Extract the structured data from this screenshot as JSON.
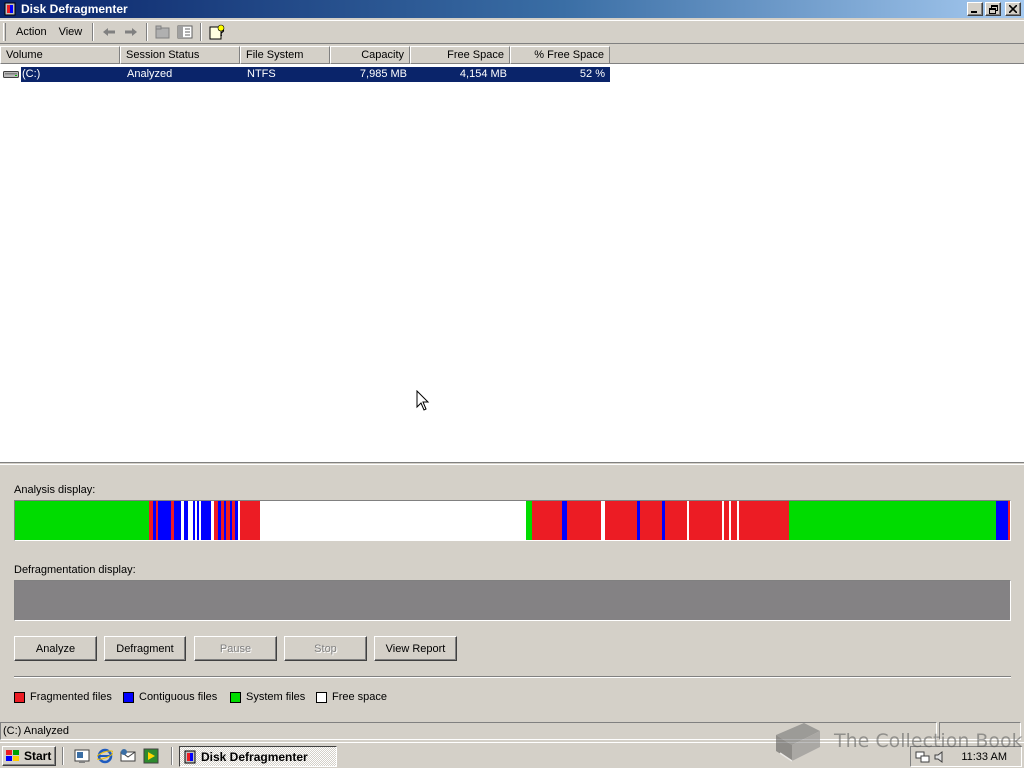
{
  "window": {
    "title": "Disk Defragmenter",
    "controls": [
      "minimize-icon",
      "restore-icon",
      "close-icon"
    ]
  },
  "menu": {
    "items": [
      {
        "label": "Action"
      },
      {
        "label": "View"
      }
    ],
    "toolbar_icons": [
      "back-arrow-icon",
      "forward-arrow-icon",
      "up-folder-icon",
      "show-hide-tree-icon",
      "help-icon"
    ]
  },
  "volume_list": {
    "columns": [
      {
        "label": "Volume"
      },
      {
        "label": "Session Status"
      },
      {
        "label": "File System"
      },
      {
        "label": "Capacity"
      },
      {
        "label": "Free Space"
      },
      {
        "label": "% Free Space"
      }
    ],
    "rows": [
      {
        "volume": "(C:)",
        "session_status": "Analyzed",
        "file_system": "NTFS",
        "capacity": "7,985 MB",
        "free_space": "4,154 MB",
        "percent_free": "52 %",
        "selected": true
      }
    ]
  },
  "analysis": {
    "label": "Analysis display:",
    "segments": [
      {
        "type": "system",
        "units": 124
      },
      {
        "type": "fragmented",
        "units": 3
      },
      {
        "type": "contiguous",
        "units": 3
      },
      {
        "type": "fragmented",
        "units": 2
      },
      {
        "type": "contiguous",
        "units": 12
      },
      {
        "type": "fragmented",
        "units": 3
      },
      {
        "type": "contiguous",
        "units": 6
      },
      {
        "type": "free",
        "units": 3
      },
      {
        "type": "contiguous",
        "units": 4
      },
      {
        "type": "free",
        "units": 4
      },
      {
        "type": "contiguous",
        "units": 2
      },
      {
        "type": "free",
        "units": 2
      },
      {
        "type": "contiguous",
        "units": 2
      },
      {
        "type": "free",
        "units": 2
      },
      {
        "type": "contiguous",
        "units": 9
      },
      {
        "type": "free",
        "units": 3
      },
      {
        "type": "fragmented",
        "units": 3
      },
      {
        "type": "contiguous",
        "units": 3
      },
      {
        "type": "fragmented",
        "units": 3
      },
      {
        "type": "contiguous",
        "units": 2
      },
      {
        "type": "fragmented",
        "units": 3
      },
      {
        "type": "contiguous",
        "units": 2
      },
      {
        "type": "fragmented",
        "units": 3
      },
      {
        "type": "contiguous",
        "units": 3
      },
      {
        "type": "free",
        "units": 2
      },
      {
        "type": "fragmented",
        "units": 18
      },
      {
        "type": "free",
        "units": 245
      },
      {
        "type": "system",
        "units": 6
      },
      {
        "type": "fragmented",
        "units": 28
      },
      {
        "type": "contiguous",
        "units": 4
      },
      {
        "type": "fragmented",
        "units": 32
      },
      {
        "type": "free",
        "units": 3
      },
      {
        "type": "fragmented",
        "units": 30
      },
      {
        "type": "contiguous",
        "units": 3
      },
      {
        "type": "fragmented",
        "units": 20
      },
      {
        "type": "contiguous",
        "units": 3
      },
      {
        "type": "fragmented",
        "units": 20
      },
      {
        "type": "free",
        "units": 2
      },
      {
        "type": "fragmented",
        "units": 30
      },
      {
        "type": "free",
        "units": 2
      },
      {
        "type": "fragmented",
        "units": 5
      },
      {
        "type": "free",
        "units": 2
      },
      {
        "type": "fragmented",
        "units": 5
      },
      {
        "type": "free",
        "units": 2
      },
      {
        "type": "fragmented",
        "units": 46
      },
      {
        "type": "system",
        "units": 191
      },
      {
        "type": "contiguous",
        "units": 11
      },
      {
        "type": "fragmented",
        "units": 2
      }
    ]
  },
  "defragmentation": {
    "label": "Defragmentation display:"
  },
  "buttons": {
    "analyze": {
      "label": "Analyze",
      "enabled": true
    },
    "defragment": {
      "label": "Defragment",
      "enabled": true
    },
    "pause": {
      "label": "Pause",
      "enabled": false
    },
    "stop": {
      "label": "Stop",
      "enabled": false
    },
    "view_report": {
      "label": "View Report",
      "enabled": true
    }
  },
  "legend": [
    {
      "label": "Fragmented files",
      "type": "fragmented"
    },
    {
      "label": "Contiguous files",
      "type": "contiguous"
    },
    {
      "label": "System files",
      "type": "system"
    },
    {
      "label": "Free space",
      "type": "free"
    }
  ],
  "colors": {
    "fragmented": "#ec1c24",
    "contiguous": "#0000ff",
    "system": "#00dc00",
    "free": "#ffffff",
    "defrag_background": "#848284",
    "selection": "#0a246a"
  },
  "status_bar": {
    "text": "(C:) Analyzed"
  },
  "taskbar": {
    "start_label": "Start",
    "quick_launch": [
      "show-desktop-icon",
      "internet-explorer-icon",
      "outlook-express-icon",
      "media-player-icon"
    ],
    "active_task": "Disk Defragmenter",
    "clock": "11:33 AM",
    "tray_icons": [
      "network-icon",
      "volume-icon"
    ]
  },
  "watermark": {
    "text": "The Collection Book"
  }
}
